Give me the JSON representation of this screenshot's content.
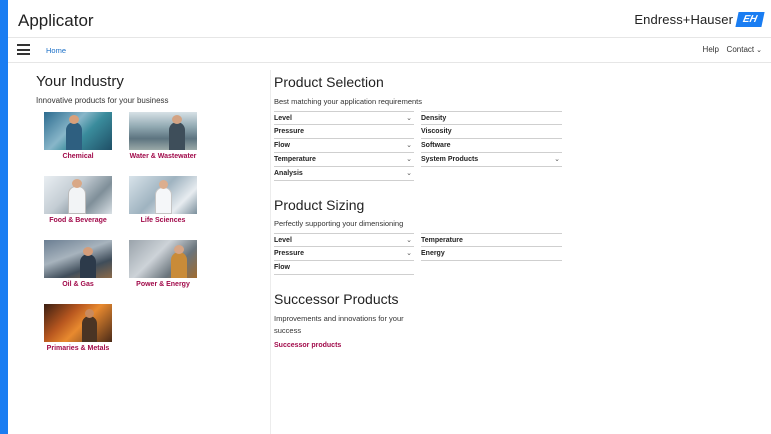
{
  "header": {
    "app_title": "Applicator",
    "brand_name": "Endress+Hauser",
    "brand_logo": "EH"
  },
  "nav": {
    "home": "Home",
    "help": "Help",
    "contact": "Contact"
  },
  "industry": {
    "title": "Your Industry",
    "subtitle": "Innovative products for your business",
    "tiles": [
      {
        "label": "Chemical"
      },
      {
        "label": "Water & Wastewater"
      },
      {
        "label": "Food & Beverage"
      },
      {
        "label": "Life Sciences"
      },
      {
        "label": "Oil & Gas"
      },
      {
        "label": "Power & Energy"
      },
      {
        "label": "Primaries & Metals"
      }
    ]
  },
  "selection": {
    "title": "Product Selection",
    "subtitle": "Best matching your application requirements",
    "left": [
      {
        "label": "Level",
        "dropdown": true
      },
      {
        "label": "Pressure",
        "dropdown": false
      },
      {
        "label": "Flow",
        "dropdown": true
      },
      {
        "label": "Temperature",
        "dropdown": true
      },
      {
        "label": "Analysis",
        "dropdown": true
      }
    ],
    "right": [
      {
        "label": "Density",
        "dropdown": false
      },
      {
        "label": "Viscosity",
        "dropdown": false
      },
      {
        "label": "Software",
        "dropdown": false
      },
      {
        "label": "System Products",
        "dropdown": true
      }
    ]
  },
  "sizing": {
    "title": "Product Sizing",
    "subtitle": "Perfectly supporting your dimensioning",
    "left": [
      {
        "label": "Level",
        "dropdown": true
      },
      {
        "label": "Pressure",
        "dropdown": true
      },
      {
        "label": "Flow",
        "dropdown": false
      }
    ],
    "right": [
      {
        "label": "Temperature",
        "dropdown": false
      },
      {
        "label": "Energy",
        "dropdown": false
      }
    ]
  },
  "successor": {
    "title": "Successor Products",
    "subtitle_line1": "Improvements and innovations for your",
    "subtitle_line2": "success",
    "link": "Successor products"
  },
  "colors": {
    "accent": "#1a7df2",
    "link": "#1a6fc7",
    "industry_caption": "#a10a4a"
  },
  "icons": {
    "menu": "hamburger-icon",
    "dropdown": "chevron-down-icon"
  }
}
